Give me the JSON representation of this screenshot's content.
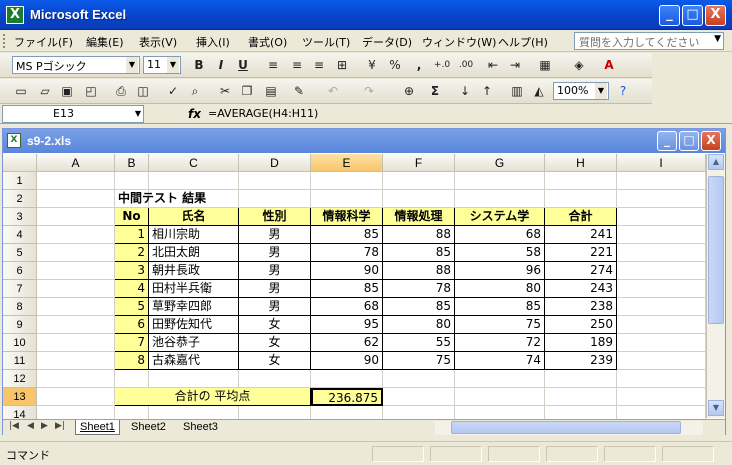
{
  "app": {
    "title": "Microsoft Excel",
    "icon": "excel-icon"
  },
  "window_controls": {
    "minimize": "_",
    "maximize": "□",
    "close": "X"
  },
  "menu": [
    "ファイル(F)",
    "編集(E)",
    "表示(V)",
    "挿入(I)",
    "書式(O)",
    "ツール(T)",
    "データ(D)",
    "ウィンドウ(W)",
    "ヘルプ(H)"
  ],
  "help_placeholder": "質問を入力してください",
  "format_toolbar": {
    "font": "MS Pゴシック",
    "size": "11",
    "bold": "B",
    "italic": "I",
    "underline": "U",
    "percent": "%",
    "comma": ",",
    "inc_decimal": "+.0",
    "dec_decimal": ".00"
  },
  "std_toolbar": {
    "zoom": "100%",
    "sigma": "Σ"
  },
  "name_box": "E13",
  "formula_fx": "fx",
  "formula": "=AVERAGE(H4:H11)",
  "workbook": {
    "title": "s9-2.xls"
  },
  "columns": [
    "A",
    "B",
    "C",
    "D",
    "E",
    "F",
    "G",
    "H",
    "I"
  ],
  "rows": [
    "1",
    "2",
    "3",
    "4",
    "5",
    "6",
    "7",
    "8",
    "9",
    "10",
    "11",
    "12",
    "13",
    "14"
  ],
  "table": {
    "title": "中間テスト 結果",
    "headers": [
      "No",
      "氏名",
      "性別",
      "情報科学",
      "情報処理",
      "システム学",
      "合計"
    ],
    "records": [
      [
        "1",
        "相川宗助",
        "男",
        "85",
        "88",
        "68",
        "241"
      ],
      [
        "2",
        "北田太朗",
        "男",
        "78",
        "85",
        "58",
        "221"
      ],
      [
        "3",
        "朝井長政",
        "男",
        "90",
        "88",
        "96",
        "274"
      ],
      [
        "4",
        "田村半兵衛",
        "男",
        "85",
        "78",
        "80",
        "243"
      ],
      [
        "5",
        "草野幸四郎",
        "男",
        "68",
        "85",
        "85",
        "238"
      ],
      [
        "6",
        "田野佐知代",
        "女",
        "95",
        "80",
        "75",
        "250"
      ],
      [
        "7",
        "池谷恭子",
        "女",
        "62",
        "55",
        "72",
        "189"
      ],
      [
        "8",
        "古森嘉代",
        "女",
        "90",
        "75",
        "74",
        "239"
      ]
    ],
    "avg_label": "合計の 平均点",
    "avg_value": "236.875"
  },
  "sheets": [
    "Sheet1",
    "Sheet2",
    "Sheet3"
  ],
  "tab_nav": [
    "|◀",
    "◀",
    "▶",
    "▶|"
  ],
  "status": "コマンド"
}
